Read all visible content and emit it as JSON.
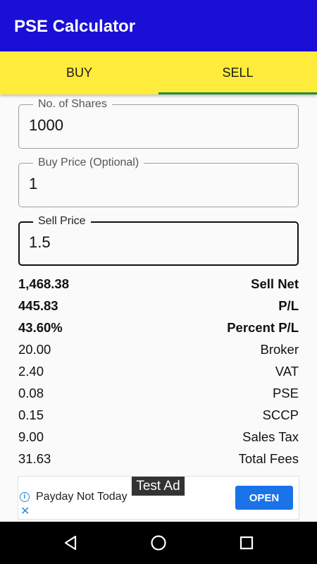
{
  "app": {
    "title": "PSE Calculator"
  },
  "tabs": [
    {
      "label": "BUY",
      "selected": false
    },
    {
      "label": "SELL",
      "selected": true
    }
  ],
  "fields": {
    "shares": {
      "label": "No. of Shares",
      "value": "1000"
    },
    "buy_price": {
      "label": "Buy Price (Optional)",
      "value": "1"
    },
    "sell_price": {
      "label": "Sell Price",
      "value": "1.5"
    }
  },
  "results": [
    {
      "value": "1,468.38",
      "label": "Sell Net",
      "bold": true
    },
    {
      "value": "445.83",
      "label": "P/L",
      "bold": true
    },
    {
      "value": "43.60%",
      "label": "Percent P/L",
      "bold": true
    },
    {
      "value": "20.00",
      "label": "Broker",
      "bold": false
    },
    {
      "value": "2.40",
      "label": "VAT",
      "bold": false
    },
    {
      "value": "0.08",
      "label": "PSE",
      "bold": false
    },
    {
      "value": "0.15",
      "label": "SCCP",
      "bold": false
    },
    {
      "value": "9.00",
      "label": "Sales Tax",
      "bold": false
    },
    {
      "value": "31.63",
      "label": "Total Fees",
      "bold": false
    }
  ],
  "ad": {
    "badge": "Test Ad",
    "text": "Payday Not Today",
    "button": "OPEN",
    "info_icon": "info-icon",
    "close_icon": "close-icon"
  },
  "colors": {
    "appbar": "#1a0fd6",
    "tabs": "#ffeb3b",
    "tab_indicator": "#1f8f3a",
    "ad_button": "#1a73e8"
  },
  "navbar": {
    "icons": [
      "back-icon",
      "home-icon",
      "recents-icon"
    ]
  }
}
